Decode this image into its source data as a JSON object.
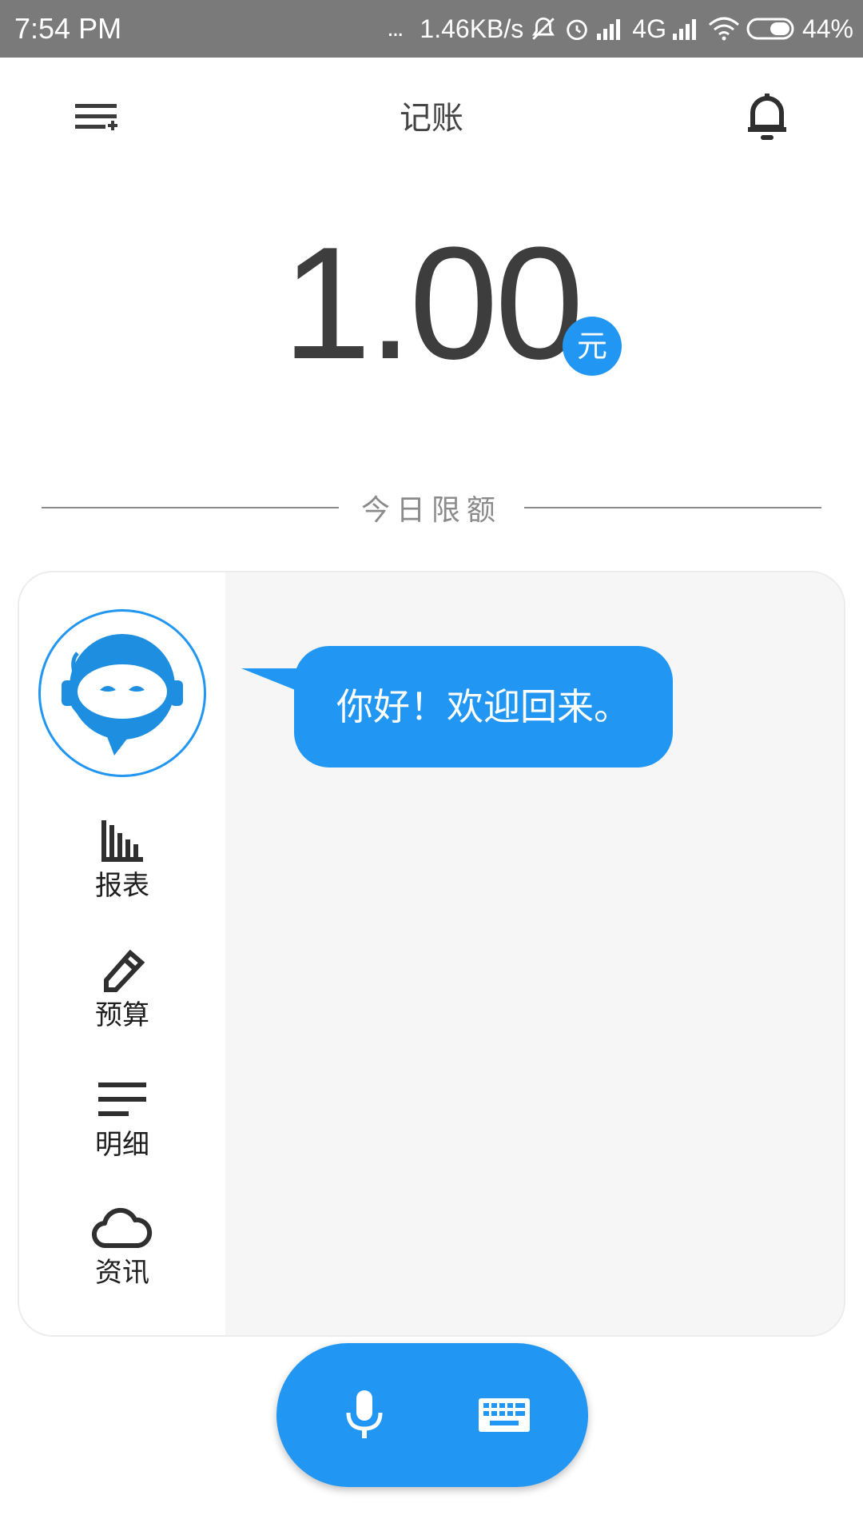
{
  "status_bar": {
    "time": "7:54 PM",
    "dots": "...",
    "speed": "1.46KB/s",
    "network": "4G",
    "battery": "44%"
  },
  "app_bar": {
    "title": "记账",
    "menu_icon": "menu-add-icon",
    "bell_icon": "bell-icon"
  },
  "summary": {
    "amount": "1.00",
    "unit": "元",
    "limit_label": "今日限额"
  },
  "assistant": {
    "greeting": "你好！欢迎回来。",
    "avatar_icon": "robot-headset-icon"
  },
  "nav": {
    "items": [
      {
        "label": "报表",
        "icon": "bar-chart-icon"
      },
      {
        "label": "预算",
        "icon": "pencil-icon"
      },
      {
        "label": "明细",
        "icon": "list-icon"
      },
      {
        "label": "资讯",
        "icon": "cloud-icon"
      }
    ]
  },
  "input": {
    "mic_icon": "microphone-icon",
    "keyboard_icon": "keyboard-icon"
  },
  "colors": {
    "accent": "#2196f3",
    "status_bar": "#7a7a7a",
    "chat_background": "#f6f6f6"
  }
}
